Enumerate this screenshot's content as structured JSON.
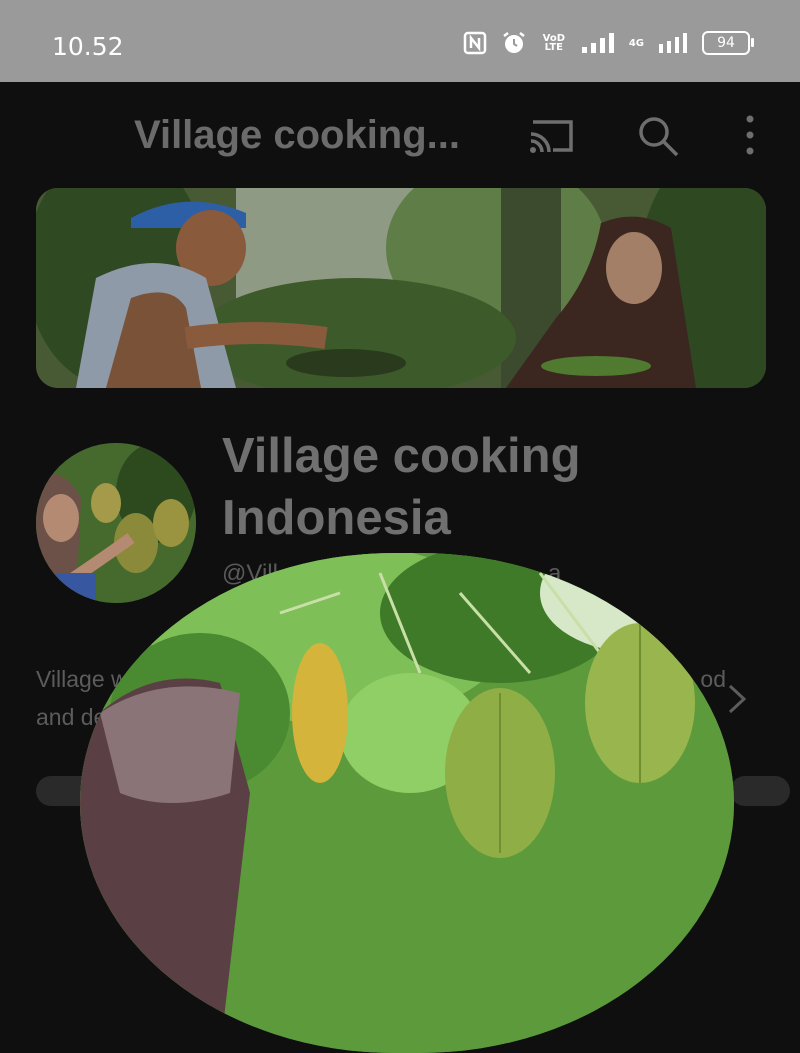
{
  "status_bar": {
    "time": "10.52",
    "volte_label": "VoD LTE",
    "network_label": "4G",
    "battery": "94"
  },
  "app_bar": {
    "title": "Village cooking..."
  },
  "channel": {
    "name": "Village cooking Indonesia",
    "handle": "@Vill",
    "handle_tail": "a",
    "description_line1_start": "Village w",
    "description_line1_end": "od",
    "description_line2_start": "and de"
  },
  "colors": {
    "status_bar_bg": "#9a9a9a",
    "page_bg": "#0f0f0f"
  }
}
